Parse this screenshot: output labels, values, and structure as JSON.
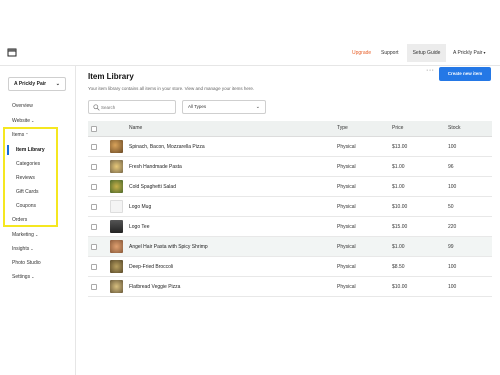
{
  "topbar": {
    "upgrade": "Upgrade",
    "support": "Support",
    "setup_guide": "Setup Guide",
    "store_name": "A Prickly Pair"
  },
  "sidebar": {
    "store_select": "A Prickly Pair",
    "items": {
      "overview": "Overview",
      "website": "Website",
      "items": "Items",
      "item_library": "Item Library",
      "categories": "Categories",
      "reviews": "Reviews",
      "gift_cards": "Gift Cards",
      "coupons": "Coupons",
      "orders": "Orders",
      "marketing": "Marketing",
      "insights": "Insights",
      "photo_studio": "Photo Studio",
      "settings": "Settings"
    }
  },
  "main": {
    "title": "Item Library",
    "subtitle": "Your item library contains all items in your store. View and manage your items here.",
    "more": "···",
    "create_button": "Create new item",
    "search_placeholder": "Search",
    "filter": "All Types"
  },
  "table": {
    "headers": {
      "name": "Name",
      "type": "Type",
      "price": "Price",
      "stock": "Stock"
    },
    "rows": [
      {
        "name": "Spinach, Bacon, Mozzarella Pizza",
        "type": "Physical",
        "price": "$13.00",
        "stock": "100"
      },
      {
        "name": "Fresh Handmade Pasta",
        "type": "Physical",
        "price": "$1.00",
        "stock": "96"
      },
      {
        "name": "Cold Spaghetti Salad",
        "type": "Physical",
        "price": "$1.00",
        "stock": "100"
      },
      {
        "name": "Logo Mug",
        "type": "Physical",
        "price": "$10.00",
        "stock": "50"
      },
      {
        "name": "Logo Tee",
        "type": "Physical",
        "price": "$15.00",
        "stock": "220"
      },
      {
        "name": "Angel Hair Pasta with Spicy Shrimp",
        "type": "Physical",
        "price": "$1.00",
        "stock": "99"
      },
      {
        "name": "Deep-Fried Broccoli",
        "type": "Physical",
        "price": "$8.50",
        "stock": "100"
      },
      {
        "name": "Flatbread Veggie Pizza",
        "type": "Physical",
        "price": "$10.00",
        "stock": "100"
      }
    ]
  },
  "colors": {
    "accent": "#2478e6",
    "upgrade": "#e8622c",
    "highlight": "#f5e720"
  }
}
